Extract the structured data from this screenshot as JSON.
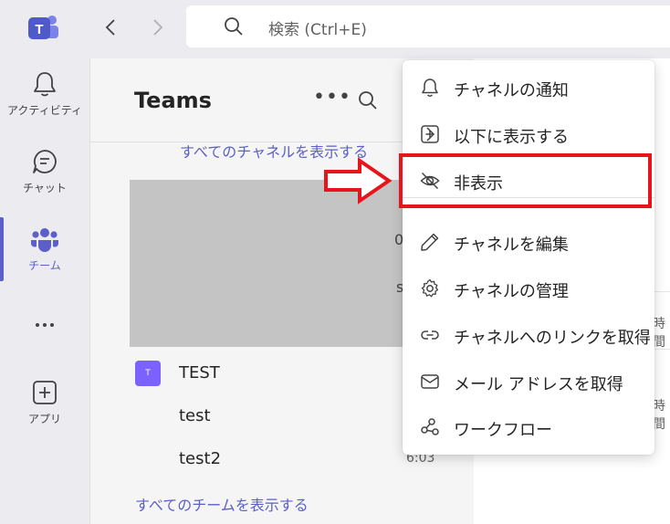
{
  "search": {
    "placeholder": "検索 (Ctrl+E)"
  },
  "rail": {
    "items": [
      {
        "label": "アクティビティ",
        "icon": "bell-icon"
      },
      {
        "label": "チャット",
        "icon": "chat-icon"
      },
      {
        "label": "チーム",
        "icon": "teams-icon",
        "active": true
      },
      {
        "label": "",
        "icon": "more-icon"
      },
      {
        "label": "アプリ",
        "icon": "add-apps-icon"
      }
    ]
  },
  "panel": {
    "title": "Teams",
    "show_all_channels": "すべてのチャネルを表示する",
    "team": {
      "avatar_letter": "T",
      "name": "TEST"
    },
    "channels": [
      {
        "name": "test",
        "time": ""
      },
      {
        "name": "test2",
        "time": "6:03"
      }
    ],
    "show_all_teams": "すべてのチームを表示する",
    "edge_fragments": [
      "0",
      "s"
    ]
  },
  "right": {
    "fragments": [
      "時間",
      "時間"
    ]
  },
  "menu": {
    "items": [
      {
        "label": "チャネルの通知",
        "icon": "bell-icon"
      },
      {
        "label": "以下に表示する",
        "icon": "add-square-icon",
        "submenu": true
      },
      {
        "label": "非表示",
        "icon": "eye-off-icon",
        "highlighted": true
      },
      {
        "label": "チャネルを編集",
        "icon": "pencil-icon"
      },
      {
        "label": "チャネルの管理",
        "icon": "gear-icon"
      },
      {
        "label": "チャネルへのリンクを取得",
        "icon": "link-icon"
      },
      {
        "label": "メール アドレスを取得",
        "icon": "mail-icon"
      },
      {
        "label": "ワークフロー",
        "icon": "workflow-icon"
      }
    ]
  },
  "colors": {
    "accent": "#5b5fc7",
    "highlight_red": "#e8141c",
    "team_avatar": "#7b61ff"
  }
}
